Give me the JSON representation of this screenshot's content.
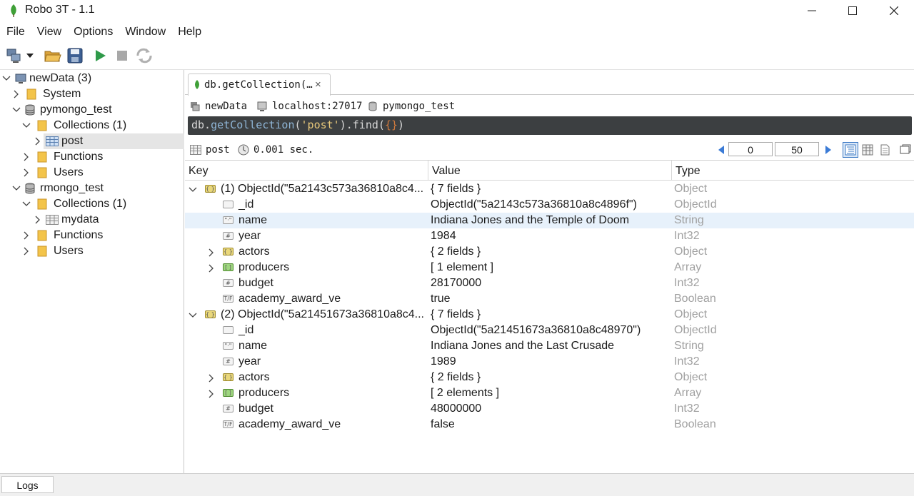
{
  "window": {
    "title": "Robo 3T - 1.1"
  },
  "menu": [
    "File",
    "View",
    "Options",
    "Window",
    "Help"
  ],
  "toolbar": {
    "icons": [
      "connect-icon",
      "dropdown-icon",
      "open-icon",
      "save-icon",
      "execute-icon",
      "stop-icon",
      "refresh-icon"
    ]
  },
  "tree": {
    "nodes": [
      {
        "label": "newData (3)"
      },
      {
        "label": "System"
      },
      {
        "label": "pymongo_test"
      },
      {
        "label": "Collections (1)"
      },
      {
        "label": "post"
      },
      {
        "label": "Functions"
      },
      {
        "label": "Users"
      },
      {
        "label": "rmongo_test"
      },
      {
        "label": "Collections (1)"
      },
      {
        "label": "mydata"
      },
      {
        "label": "Functions"
      },
      {
        "label": "Users"
      }
    ]
  },
  "tab": {
    "label": "db.getCollection(…",
    "close": "×"
  },
  "info": {
    "connection": "newData",
    "server": "localhost:27017",
    "database": "pymongo_test"
  },
  "query": {
    "prefix": "db.",
    "fn": "getCollection",
    "open": "(",
    "arg": "'post'",
    "mid": ").find(",
    "braces": "{}",
    "close": ")"
  },
  "status": {
    "collection": "post",
    "time": "0.001 sec.",
    "skip": "0",
    "limit": "50"
  },
  "grid": {
    "headers": {
      "key": "Key",
      "value": "Value",
      "type": "Type"
    },
    "rows": [
      {
        "key": "(1) ObjectId(\"5a2143c573a36810a8c4...",
        "value": "{ 7 fields }",
        "type": "Object"
      },
      {
        "key": "_id",
        "value": "ObjectId(\"5a2143c573a36810a8c4896f\")",
        "type": "ObjectId"
      },
      {
        "key": "name",
        "value": "Indiana Jones and the Temple of Doom",
        "type": "String"
      },
      {
        "key": "year",
        "value": "1984",
        "type": "Int32"
      },
      {
        "key": "actors",
        "value": "{ 2 fields }",
        "type": "Object"
      },
      {
        "key": "producers",
        "value": "[ 1 element ]",
        "type": "Array"
      },
      {
        "key": "budget",
        "value": "28170000",
        "type": "Int32"
      },
      {
        "key": "academy_award_ve",
        "value": "true",
        "type": "Boolean"
      },
      {
        "key": "(2) ObjectId(\"5a21451673a36810a8c4...",
        "value": "{ 7 fields }",
        "type": "Object"
      },
      {
        "key": "_id",
        "value": "ObjectId(\"5a21451673a36810a8c48970\")",
        "type": "ObjectId"
      },
      {
        "key": "name",
        "value": "Indiana Jones and the Last Crusade",
        "type": "String"
      },
      {
        "key": "year",
        "value": "1989",
        "type": "Int32"
      },
      {
        "key": "actors",
        "value": "{ 2 fields }",
        "type": "Object"
      },
      {
        "key": "producers",
        "value": "[ 2 elements ]",
        "type": "Array"
      },
      {
        "key": "budget",
        "value": "48000000",
        "type": "Int32"
      },
      {
        "key": "academy_award_ve",
        "value": "false",
        "type": "Boolean"
      }
    ]
  },
  "bottom": {
    "logs": "Logs"
  },
  "colors": {
    "query_bg": "#3c3f41",
    "selection": "#e7f1fb",
    "type_text": "#a0a0a0"
  }
}
